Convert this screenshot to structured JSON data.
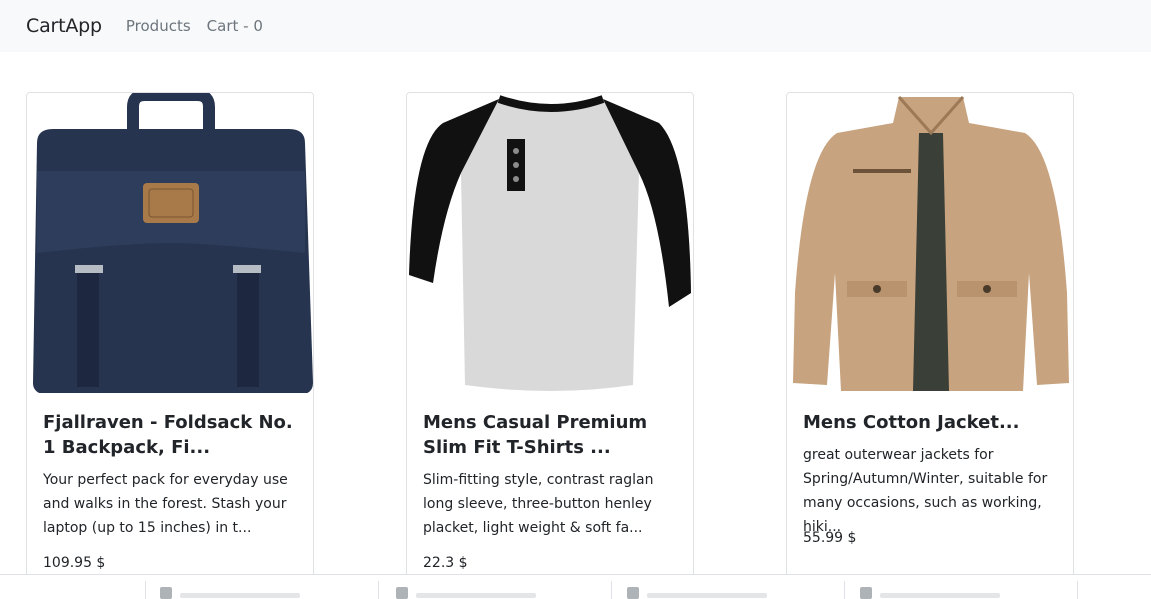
{
  "navbar": {
    "brand": "CartApp",
    "links": [
      {
        "label": "Products"
      },
      {
        "label": "Cart - 0"
      }
    ]
  },
  "products": [
    {
      "title": "Fjallraven - Foldsack No. 1 Backpack, Fi...",
      "description": "Your perfect pack for everyday use and walks in the forest. Stash your laptop (up to 15 inches) in t...",
      "price": "109.95 $",
      "image": "backpack"
    },
    {
      "title": "Mens Casual Premium Slim Fit T-Shirts ...",
      "description": "Slim-fitting style, contrast raglan long sleeve, three-button henley placket, light weight & soft fa...",
      "price": "22.3 $",
      "image": "raglan-t-shirt"
    },
    {
      "title": "Mens Cotton Jacket...",
      "description": "great outerwear jackets for Spring/Autumn/Winter, suitable for many occasions, such as working, hiki...",
      "price": "55.99 $",
      "image": "cotton-jacket"
    }
  ],
  "colors": {
    "navbar_bg": "#f8f9fa",
    "backpack": "#27344f",
    "tshirt_grey": "#d9d9d9",
    "tshirt_black": "#111111",
    "jacket": "#c7a37f"
  }
}
